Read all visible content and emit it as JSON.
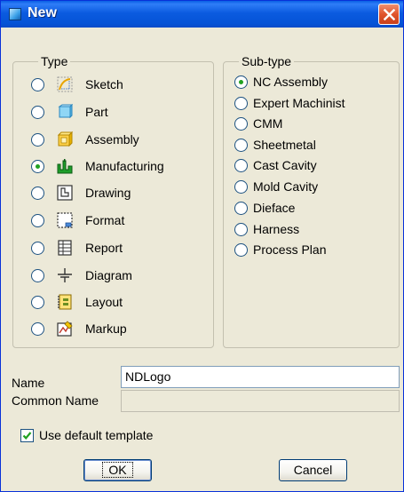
{
  "window": {
    "title": "New"
  },
  "type_group": {
    "legend": "Type",
    "items": [
      {
        "label": "Sketch",
        "icon": "sketch-icon",
        "checked": false
      },
      {
        "label": "Part",
        "icon": "part-icon",
        "checked": false
      },
      {
        "label": "Assembly",
        "icon": "assembly-icon",
        "checked": false
      },
      {
        "label": "Manufacturing",
        "icon": "manufacturing-icon",
        "checked": true
      },
      {
        "label": "Drawing",
        "icon": "drawing-icon",
        "checked": false
      },
      {
        "label": "Format",
        "icon": "format-icon",
        "checked": false
      },
      {
        "label": "Report",
        "icon": "report-icon",
        "checked": false
      },
      {
        "label": "Diagram",
        "icon": "diagram-icon",
        "checked": false
      },
      {
        "label": "Layout",
        "icon": "layout-icon",
        "checked": false
      },
      {
        "label": "Markup",
        "icon": "markup-icon",
        "checked": false
      }
    ]
  },
  "subtype_group": {
    "legend": "Sub-type",
    "items": [
      {
        "label": "NC Assembly",
        "checked": true
      },
      {
        "label": "Expert Machinist",
        "checked": false
      },
      {
        "label": "CMM",
        "checked": false
      },
      {
        "label": "Sheetmetal",
        "checked": false
      },
      {
        "label": "Cast Cavity",
        "checked": false
      },
      {
        "label": "Mold Cavity",
        "checked": false
      },
      {
        "label": "Dieface",
        "checked": false
      },
      {
        "label": "Harness",
        "checked": false
      },
      {
        "label": "Process Plan",
        "checked": false
      }
    ]
  },
  "name_field": {
    "label": "Name",
    "value": "NDLogo"
  },
  "common_name_field": {
    "label": "Common Name",
    "value": ""
  },
  "use_default_template": {
    "label": "Use default template",
    "checked": true
  },
  "buttons": {
    "ok": "OK",
    "cancel": "Cancel"
  },
  "colors": {
    "titlebar": "#0553d6",
    "dialog_bg": "#ece9d8",
    "close_button": "#e0542c",
    "radio_dot": "#21a121"
  }
}
